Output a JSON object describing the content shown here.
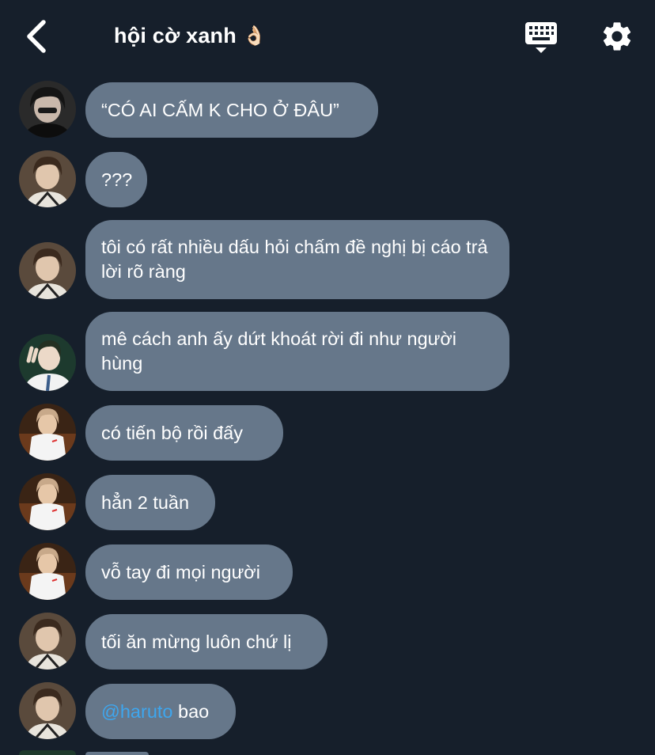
{
  "header": {
    "title": "hội cờ xanh",
    "title_emoji": "👌🏻",
    "back_icon": "chevron-left-icon",
    "keyboard_icon": "keyboard-icon",
    "settings_icon": "gear-icon"
  },
  "colors": {
    "background": "#161f2b",
    "bubble": "#66778a",
    "mention": "#3ea6ee"
  },
  "messages": [
    {
      "text": "“CÓ AI CẤM K CHO Ở ĐÂU”",
      "avatar": "avatar-dark-hair"
    },
    {
      "text": "???",
      "avatar": "avatar-brown-hair"
    },
    {
      "text": "tôi có rất nhiều dấu hỏi chấm đề nghị bị cáo trả lời rõ ràng",
      "avatar": "avatar-brown-hair"
    },
    {
      "text": "mê cách anh ấy dứt khoát rời đi như người hùng",
      "avatar": "avatar-peace-sign"
    },
    {
      "text": "có tiến bộ rồi đấy",
      "avatar": "avatar-white-shirt"
    },
    {
      "text": "hẳn 2 tuần",
      "avatar": "avatar-white-shirt"
    },
    {
      "text": "vỗ tay đi mọi người",
      "avatar": "avatar-white-shirt"
    },
    {
      "text": "tối ăn mừng luôn chứ lị",
      "avatar": "avatar-brown-hair"
    },
    {
      "mention": "@haruto",
      "text": " bao",
      "avatar": "avatar-brown-hair"
    }
  ]
}
